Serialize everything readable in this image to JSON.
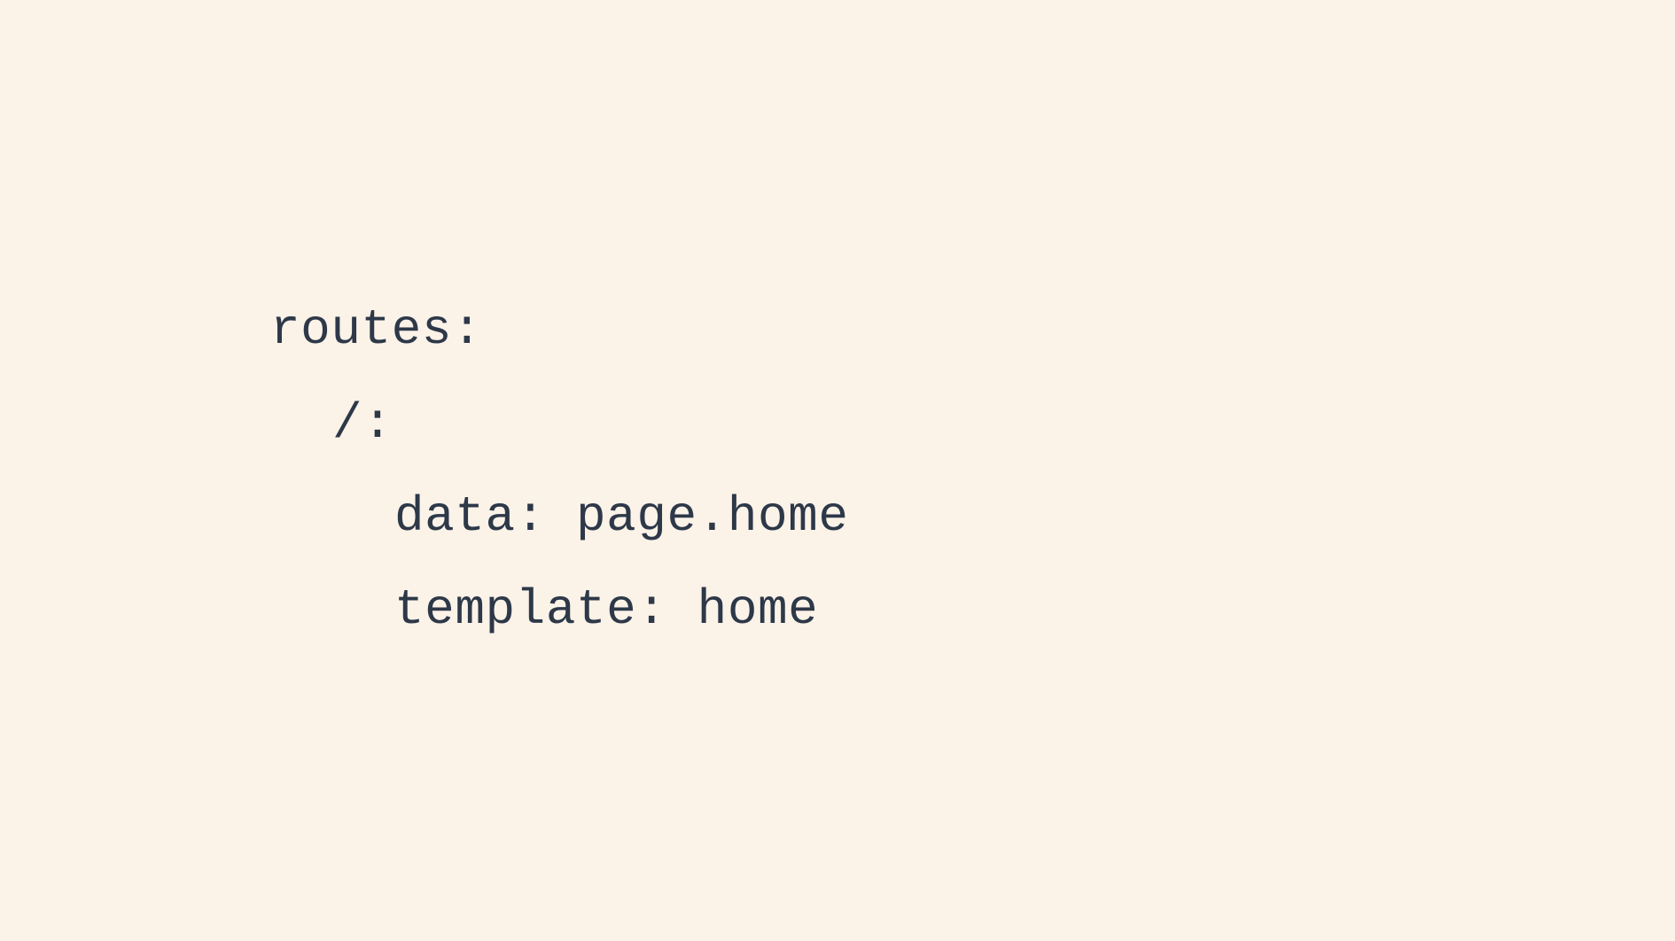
{
  "code": {
    "line1": "routes:",
    "line2": "/:",
    "line3": "data: page.home",
    "line4": "template: home"
  }
}
